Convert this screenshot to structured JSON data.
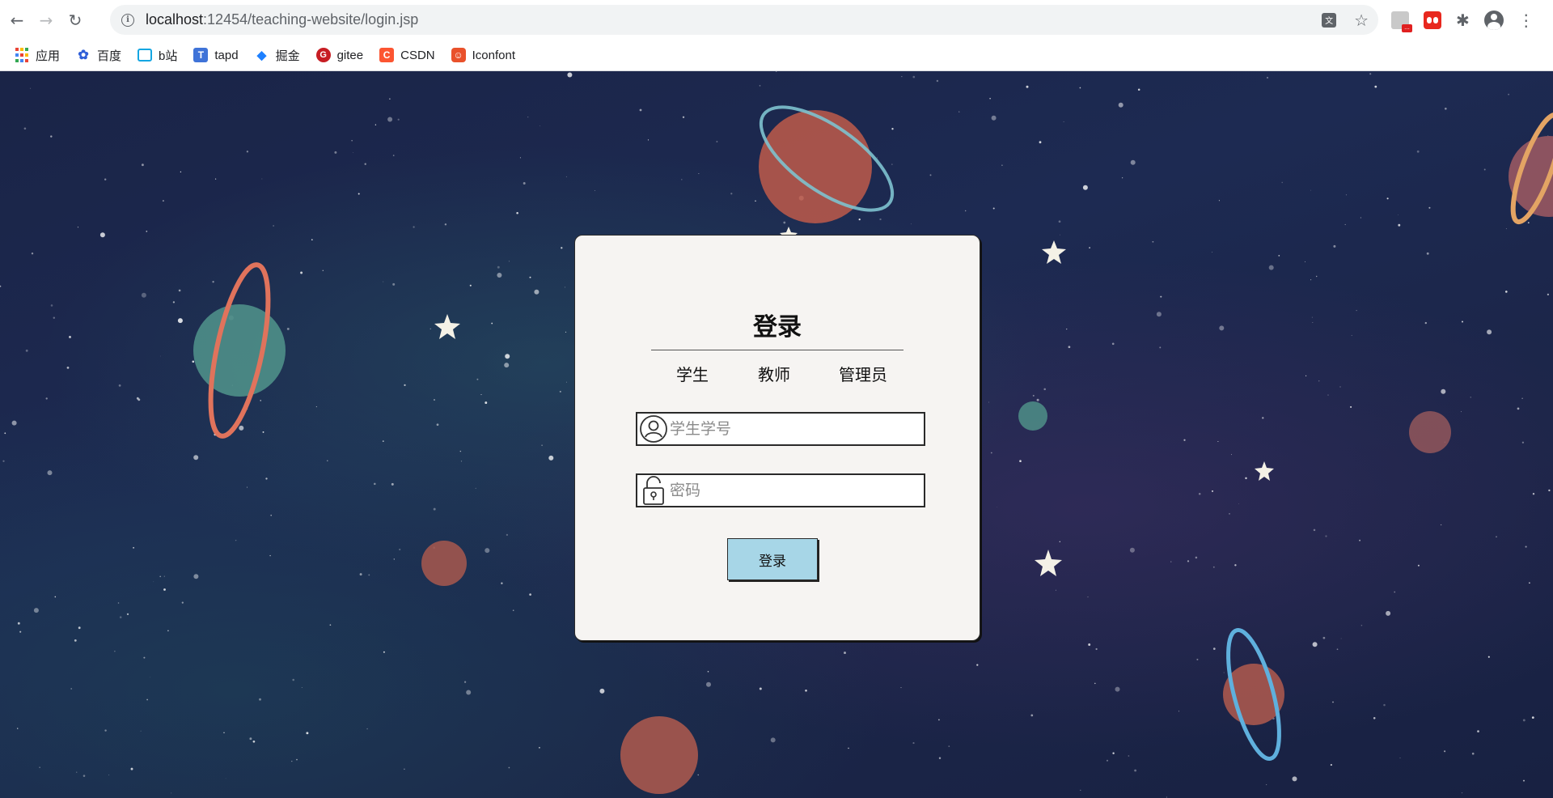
{
  "browser": {
    "url_host": "localhost",
    "url_rest": ":12454/teaching-website/login.jsp",
    "back_glyph": "←",
    "forward_glyph": "→",
    "reload_glyph": "↻",
    "star_glyph": "☆",
    "puzzle_glyph": "✱",
    "menu_glyph": "⋮",
    "translate_glyph": "文",
    "extension_badge": "..."
  },
  "bookmarks": [
    {
      "label": "应用",
      "icon": "apps-grid-icon"
    },
    {
      "label": "百度",
      "icon": "baidu-icon",
      "glyph": "✿"
    },
    {
      "label": "b站",
      "icon": "bilibili-icon",
      "glyph": ""
    },
    {
      "label": "tapd",
      "icon": "tapd-icon",
      "glyph": "T"
    },
    {
      "label": "掘金",
      "icon": "juejin-icon",
      "glyph": "◆"
    },
    {
      "label": "gitee",
      "icon": "gitee-icon",
      "glyph": "G"
    },
    {
      "label": "CSDN",
      "icon": "csdn-icon",
      "glyph": "C"
    },
    {
      "label": "Iconfont",
      "icon": "iconfont-icon",
      "glyph": "☺"
    }
  ],
  "login": {
    "title": "登录",
    "roles": [
      "学生",
      "教师",
      "管理员"
    ],
    "username_placeholder": "学生学号",
    "password_placeholder": "密码",
    "submit_label": "登录"
  },
  "colors": {
    "card_bg": "#f6f4f2",
    "button_bg": "#a7d6e7",
    "page_bg": "#1d2a52"
  }
}
